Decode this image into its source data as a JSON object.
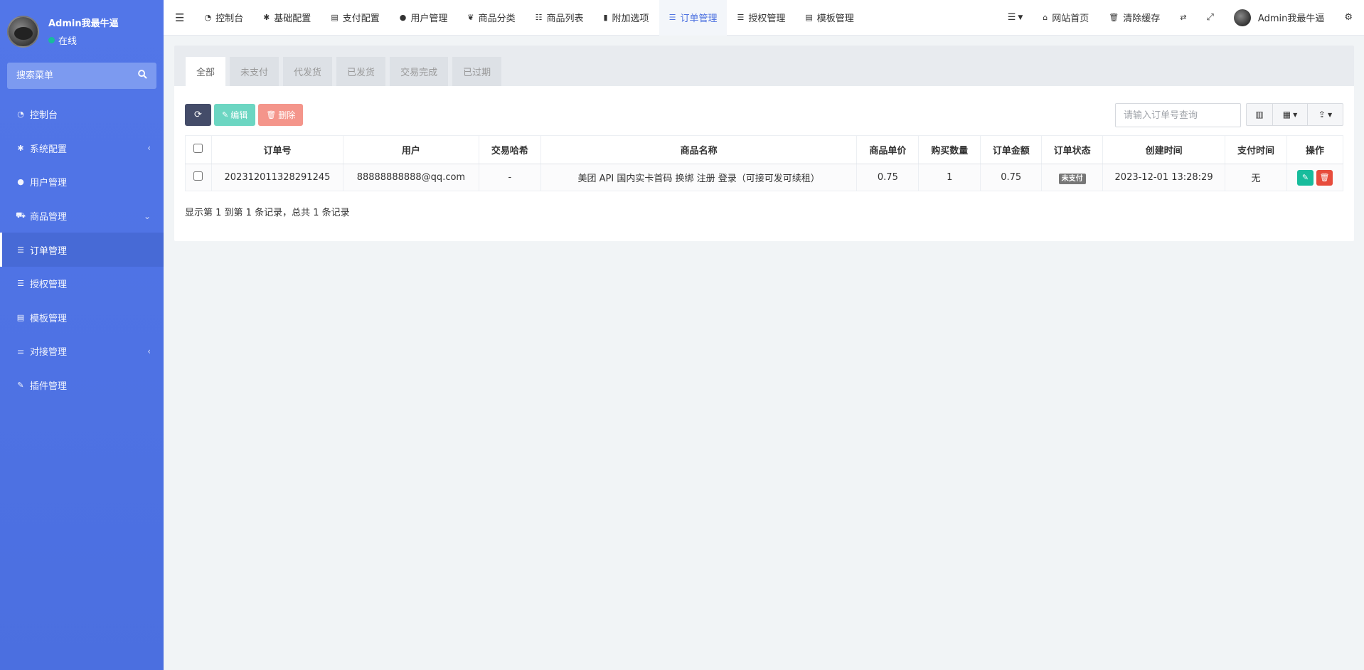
{
  "sidebar": {
    "user_name": "Admin我最牛逼",
    "user_status": "在线",
    "search_placeholder": "搜索菜单",
    "items": [
      {
        "label": "控制台",
        "icon": "dashboard-icon"
      },
      {
        "label": "系统配置",
        "icon": "gear-icon"
      },
      {
        "label": "用户管理",
        "icon": "user-icon"
      },
      {
        "label": "商品管理",
        "icon": "cart-icon"
      },
      {
        "label": "订单管理",
        "icon": "list-icon"
      },
      {
        "label": "授权管理",
        "icon": "list-icon"
      },
      {
        "label": "模板管理",
        "icon": "layout-icon"
      },
      {
        "label": "对接管理",
        "icon": "sliders-icon"
      },
      {
        "label": "插件管理",
        "icon": "plug-icon"
      }
    ]
  },
  "topnav": {
    "items": [
      {
        "label": "控制台"
      },
      {
        "label": "基础配置"
      },
      {
        "label": "支付配置"
      },
      {
        "label": "用户管理"
      },
      {
        "label": "商品分类"
      },
      {
        "label": "商品列表"
      },
      {
        "label": "附加选项"
      },
      {
        "label": "订单管理"
      },
      {
        "label": "授权管理"
      },
      {
        "label": "模板管理"
      }
    ],
    "site_home": "网站首页",
    "clear_cache": "清除缓存",
    "admin_name": "Admin我最牛逼"
  },
  "tabs": [
    "全部",
    "未支付",
    "代发货",
    "已发货",
    "交易完成",
    "已过期"
  ],
  "toolbar": {
    "edit_label": "编辑",
    "delete_label": "删除",
    "search_placeholder": "请输入订单号查询"
  },
  "table": {
    "headers": [
      "订单号",
      "用户",
      "交易哈希",
      "商品名称",
      "商品单价",
      "购买数量",
      "订单金额",
      "订单状态",
      "创建时间",
      "支付时间",
      "操作"
    ],
    "rows": [
      {
        "order_no": "202312011328291245",
        "user": "88888888888@qq.com",
        "tx_hash": "-",
        "product": "美团 API 国内实卡首码 换绑 注册 登录（可接可发可续租）",
        "unit_price": "0.75",
        "quantity": "1",
        "amount": "0.75",
        "status": "未支付",
        "created_at": "2023-12-01 13:28:29",
        "paid_at": "无"
      }
    ]
  },
  "summary": "显示第 1 到第 1 条记录，总共 1 条记录",
  "colors": {
    "sidebar": "#5276e8",
    "accent": "#4c71e0",
    "edit": "#18bc9c",
    "delete": "#e74c3c",
    "refresh": "#444c69"
  }
}
